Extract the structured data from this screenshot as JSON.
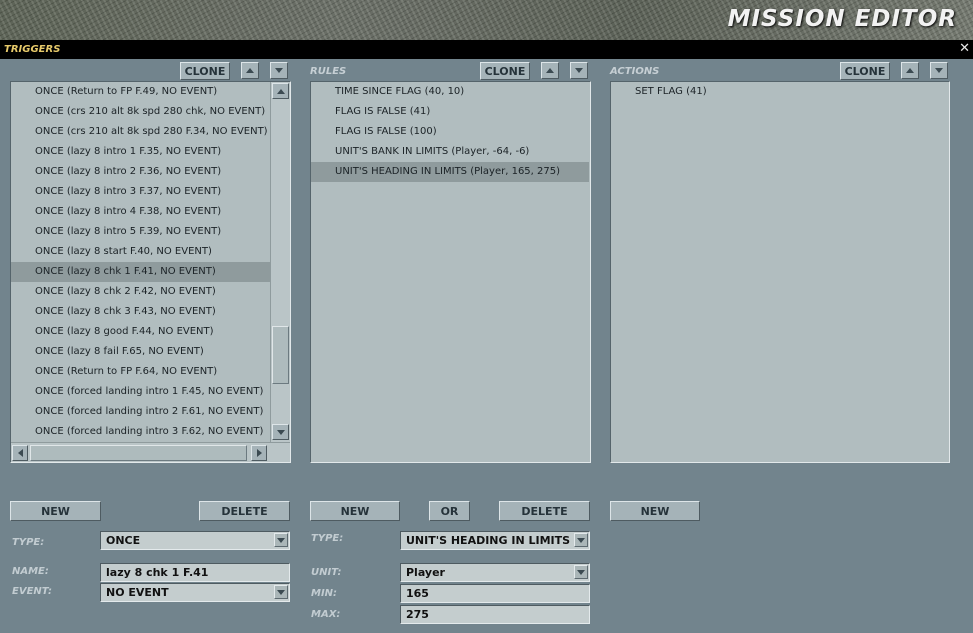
{
  "window": {
    "title": "MISSION EDITOR",
    "close_glyph": "✕"
  },
  "triggers": {
    "header": "TRIGGERS",
    "clone_label": "CLONE",
    "new_label": "NEW",
    "delete_label": "DELETE",
    "selected_index": 9,
    "scroll_position": 0.85,
    "items": [
      "ONCE (Return to FP F.49, NO EVENT)",
      "ONCE (crs 210 alt 8k spd 280 chk, NO EVENT)",
      "ONCE (crs 210 alt 8k spd 280 F.34, NO EVENT)",
      "ONCE (lazy 8 intro 1 F.35, NO EVENT)",
      "ONCE (lazy 8 intro 2 F.36, NO EVENT)",
      "ONCE (lazy 8 intro 3 F.37, NO EVENT)",
      "ONCE (lazy 8 intro 4 F.38, NO EVENT)",
      "ONCE (lazy 8 intro 5 F.39, NO EVENT)",
      "ONCE (lazy 8 start F.40, NO EVENT)",
      "ONCE (lazy 8 chk 1 F.41, NO EVENT)",
      "ONCE (lazy 8 chk 2 F.42, NO EVENT)",
      "ONCE (lazy 8 chk 3 F.43, NO EVENT)",
      "ONCE (lazy 8 good F.44, NO EVENT)",
      "ONCE (lazy 8 fail F.65, NO EVENT)",
      "ONCE (Return to FP F.64, NO EVENT)",
      "ONCE (forced landing intro 1 F.45, NO EVENT)",
      "ONCE (forced landing intro 2 F.61, NO EVENT)",
      "ONCE (forced landing intro 3 F.62, NO EVENT)"
    ],
    "type_label": "TYPE:",
    "type_value": "ONCE",
    "name_label": "NAME:",
    "name_value": "lazy 8 chk 1 F.41",
    "event_label": "EVENT:",
    "event_value": "NO EVENT"
  },
  "rules": {
    "header": "RULES",
    "clone_label": "CLONE",
    "new_label": "NEW",
    "or_label": "OR",
    "delete_label": "DELETE",
    "selected_index": 4,
    "items": [
      "TIME SINCE FLAG (40, 10)",
      "FLAG IS FALSE (41)",
      "FLAG IS FALSE (100)",
      "UNIT'S BANK IN LIMITS (Player, -64, -6)",
      "UNIT'S HEADING IN LIMITS (Player, 165, 275)"
    ],
    "type_label": "TYPE:",
    "type_value": "UNIT'S HEADING IN LIMITS",
    "unit_label": "UNIT:",
    "unit_value": "Player",
    "min_label": "MIN:",
    "min_value": "165",
    "max_label": "MAX:",
    "max_value": "275"
  },
  "actions": {
    "header": "ACTIONS",
    "clone_label": "CLONE",
    "new_label": "NEW",
    "items": [
      "SET FLAG (41)"
    ]
  }
}
